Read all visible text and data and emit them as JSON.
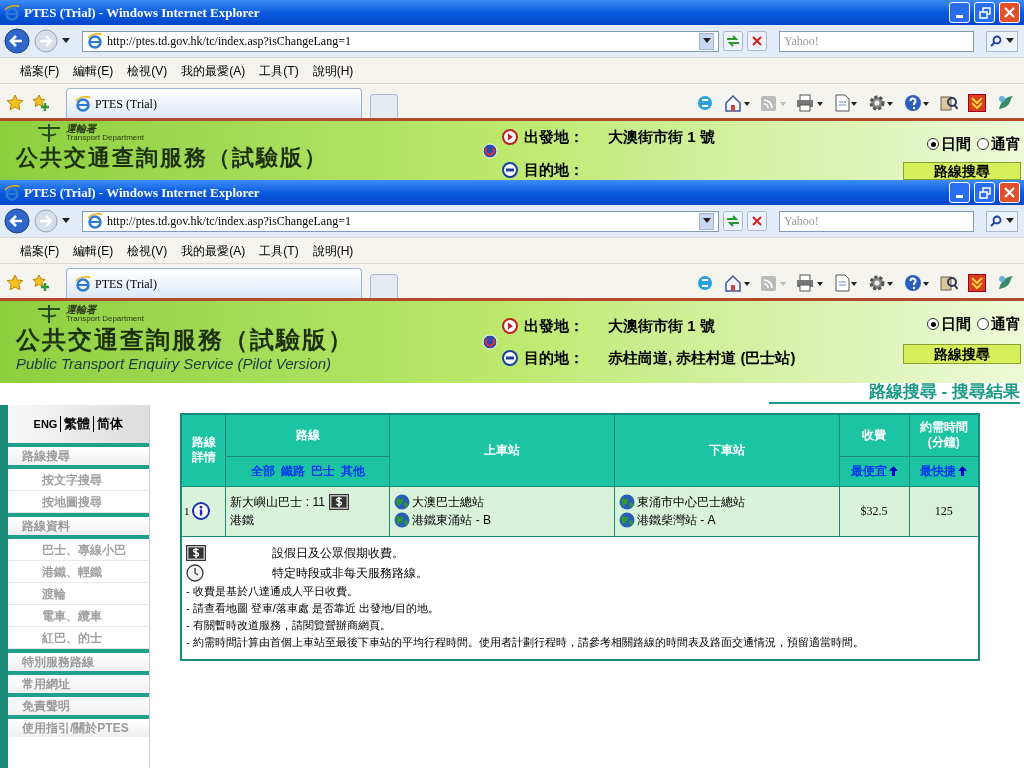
{
  "windows": [
    {
      "title": "PTES (Trial) - Windows Internet Explorer",
      "address": "http://ptes.td.gov.hk/tc/index.asp?isChangeLang=1",
      "search_placeholder": "Yahoo!",
      "menu": [
        "檔案(F)",
        "編輯(E)",
        "檢視(V)",
        "我的最愛(A)",
        "工具(T)",
        "說明(H)"
      ],
      "tab": "PTES (Trial)",
      "header": {
        "logo_text": "運輸署",
        "logo_subtext": "Transport Department",
        "title": "公共交通查詢服務（試驗版）",
        "origin_label": "出發地：",
        "origin": "大澳街市街 1 號",
        "destination_label": "目的地：",
        "time_options": [
          {
            "label": "日間",
            "selected": true
          },
          {
            "label": "通宵",
            "selected": false
          }
        ],
        "search_button": "路線搜尋"
      }
    },
    {
      "title": "PTES (Trial) - Windows Internet Explorer",
      "address": "http://ptes.td.gov.hk/tc/index.asp?isChangeLang=1",
      "search_placeholder": "Yahoo!",
      "menu": [
        "檔案(F)",
        "編輯(E)",
        "檢視(V)",
        "我的最愛(A)",
        "工具(T)",
        "說明(H)"
      ],
      "tab": "PTES (Trial)",
      "header": {
        "logo_text": "運輸署",
        "logo_subtext": "Transport Department",
        "title": "公共交通查詢服務（試驗版）",
        "subtitle": "Public Transport Enquiry Service (Pilot Version)",
        "origin_label": "出發地：",
        "origin": "大澳街市街 1 號",
        "destination_label": "目的地：",
        "destination": "赤柱崗道, 赤柱村道 (巴士站)",
        "time_options": [
          {
            "label": "日間",
            "selected": true
          },
          {
            "label": "通宵",
            "selected": false
          }
        ],
        "search_button": "路線搜尋"
      },
      "page": {
        "page_title": "路線搜尋 - 搜尋結果",
        "languages": [
          "ENG",
          "繁體",
          "简体"
        ],
        "sidebar": [
          {
            "label": "路線搜尋",
            "children": [
              {
                "label": "按文字搜尋"
              },
              {
                "label": "按地圖搜尋"
              }
            ]
          },
          {
            "label": "路線資料",
            "children": [
              {
                "label": "巴士、專線小巴"
              },
              {
                "label": "港鐵、輕鐵"
              },
              {
                "label": "渡輪"
              },
              {
                "label": "電車、纜車"
              },
              {
                "label": "紅巴、的士"
              }
            ]
          },
          {
            "label": "特別服務路線"
          },
          {
            "label": "常用網址"
          },
          {
            "label": "免責聲明"
          },
          {
            "label": "使用指引/關於PTES"
          }
        ],
        "table": {
          "col_details": "路線詳情",
          "col_route": "路線",
          "route_filters": [
            "全部",
            "鐵路",
            "巴士",
            "其他"
          ],
          "col_board": "上車站",
          "col_alight": "下車站",
          "col_fare": "收費",
          "fare_sort": "最便宜",
          "col_time": "約需時間 (分鐘)",
          "time_sort": "最快捷",
          "rows": [
            {
              "index": "1",
              "route": "新大嶼山巴士 : 11",
              "holiday_fare": true,
              "operator": "港鐵",
              "boarding": [
                "大澳巴士總站",
                "港鐵東涌站 - B"
              ],
              "alighting": [
                "東涌市中心巴士總站",
                "港鐵柴灣站 - A"
              ],
              "fare": "$32.5",
              "time": "125"
            }
          ]
        },
        "legend": [
          {
            "kind": "dollar",
            "text": "設假日及公眾假期收費。"
          },
          {
            "kind": "clock",
            "text": "特定時段或非每天服務路線。"
          }
        ],
        "notes": [
          "- 收費是基於八達通成人平日收費。",
          "- 請查看地圖 登車/落車處 是否靠近 出發地/目的地。",
          "- 有關暫時改道服務，請閱覽營辦商網頁。",
          "- 約需時間計算由首個上車站至最後下車站的平均行程時間。使用者計劃行程時，請參考相關路線的時間表及路面交通情況，預留適當時間。"
        ]
      }
    }
  ]
}
